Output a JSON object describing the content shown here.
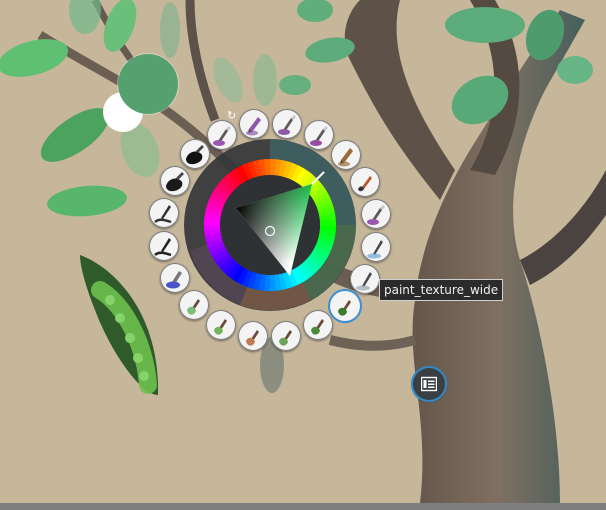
{
  "app": {
    "view": "popup-palette",
    "tooltip": "paint_texture_wide",
    "rotate_icon": "rotate-icon",
    "docker_icon": "docker-list-icon"
  },
  "colors": {
    "foreground": "#55a06f",
    "background": "#ffffff",
    "canvas": "#c6b69a",
    "selection_ring": "#3b8fd4"
  },
  "presets": [
    {
      "name": "brush-preset-1",
      "style": "stylus",
      "tint": "#8e5aa8"
    },
    {
      "name": "brush-preset-2",
      "style": "stylus",
      "tint": "#9a4ba5"
    },
    {
      "name": "brush-preset-3",
      "style": "pencil",
      "tint": "#9a6b3a"
    },
    {
      "name": "brush-preset-4",
      "style": "brush",
      "tint": "#b45a2a"
    },
    {
      "name": "brush-preset-5",
      "style": "stylus",
      "tint": "#9a56b0"
    },
    {
      "name": "brush-preset-6",
      "style": "pen",
      "tint": "#6aa6d6"
    },
    {
      "name": "brush-preset-7",
      "style": "pen",
      "tint": "#9aa6b0"
    },
    {
      "name": "brush-preset-8",
      "style": "texture",
      "tint": "#3b7a2a",
      "active": true
    },
    {
      "name": "brush-preset-9",
      "style": "texture",
      "tint": "#4a8b3b"
    },
    {
      "name": "brush-preset-10",
      "style": "texture",
      "tint": "#6ea45a"
    },
    {
      "name": "brush-preset-11",
      "style": "texture",
      "tint": "#c07a55"
    },
    {
      "name": "brush-preset-12",
      "style": "texture",
      "tint": "#75b35a"
    },
    {
      "name": "brush-preset-13",
      "style": "texture",
      "tint": "#7bbd7a"
    },
    {
      "name": "brush-preset-14",
      "style": "marker",
      "tint": "#4a54c8"
    },
    {
      "name": "brush-preset-15",
      "style": "ink",
      "tint": "#222222"
    },
    {
      "name": "brush-preset-16",
      "style": "ink",
      "tint": "#333333"
    },
    {
      "name": "brush-preset-17",
      "style": "blob",
      "tint": "#1a1a1a"
    },
    {
      "name": "brush-preset-18",
      "style": "blob",
      "tint": "#111111"
    },
    {
      "name": "brush-preset-19",
      "style": "stylus",
      "tint": "#9a56b0"
    },
    {
      "name": "brush-preset-20",
      "style": "pencil",
      "tint": "#8e5aa8"
    }
  ]
}
